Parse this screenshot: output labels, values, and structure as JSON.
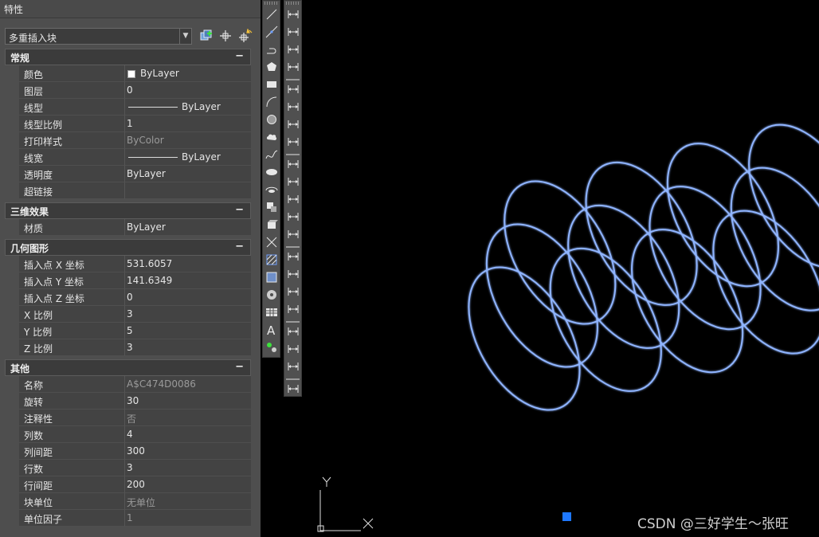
{
  "palette": {
    "title": "特性",
    "selector": "多重插入块",
    "toolbar_icons": [
      "toggle-pickadd-icon",
      "select-objects-icon",
      "quick-select-icon"
    ],
    "sections": [
      {
        "title": "常规",
        "collapse": "−",
        "rows": [
          {
            "name": "颜色",
            "value": "ByLayer",
            "glyph": "swatch"
          },
          {
            "name": "图层",
            "value": "0"
          },
          {
            "name": "线型",
            "value": "ByLayer",
            "glyph": "line"
          },
          {
            "name": "线型比例",
            "value": "1"
          },
          {
            "name": "打印样式",
            "value": "ByColor",
            "dim": true
          },
          {
            "name": "线宽",
            "value": "ByLayer",
            "glyph": "line"
          },
          {
            "name": "透明度",
            "value": "ByLayer"
          },
          {
            "name": "超链接",
            "value": ""
          }
        ]
      },
      {
        "title": "三维效果",
        "collapse": "−",
        "rows": [
          {
            "name": "材质",
            "value": "ByLayer"
          }
        ]
      },
      {
        "title": "几何图形",
        "collapse": "−",
        "rows": [
          {
            "name": "插入点 X 坐标",
            "value": "531.6057"
          },
          {
            "name": "插入点 Y 坐标",
            "value": "141.6349"
          },
          {
            "name": "插入点 Z 坐标",
            "value": "0"
          },
          {
            "name": "X 比例",
            "value": "3"
          },
          {
            "name": "Y 比例",
            "value": "5"
          },
          {
            "name": "Z 比例",
            "value": "3"
          }
        ]
      },
      {
        "title": "其他",
        "collapse": "−",
        "rows": [
          {
            "name": "名称",
            "value": "A$C474D0086",
            "dim": true
          },
          {
            "name": "旋转",
            "value": "30"
          },
          {
            "name": "注释性",
            "value": "否",
            "dim": true
          },
          {
            "name": "列数",
            "value": "4"
          },
          {
            "name": "列间距",
            "value": "300"
          },
          {
            "name": "行数",
            "value": "3"
          },
          {
            "name": "行间距",
            "value": "200"
          },
          {
            "name": "块单位",
            "value": "无单位",
            "dim": true
          },
          {
            "name": "单位因子",
            "value": "1",
            "dim": true
          }
        ]
      }
    ]
  },
  "draw_toolbar": [
    "line-icon",
    "construction-line-icon",
    "polyline-icon",
    "polygon-icon",
    "rectangle-icon",
    "arc-icon",
    "circle-icon",
    "revision-cloud-icon",
    "spline-icon",
    "ellipse-icon",
    "ellipse-arc-icon",
    "insert-block-icon",
    "make-block-icon",
    "point-icon",
    "hatch-icon",
    "gradient-icon",
    "region-icon",
    "table-icon",
    "multiline-text-icon",
    "add-selected-icon"
  ],
  "dim_toolbar": [
    "linear-dimension-icon",
    "aligned-dimension-icon",
    "arc-length-icon",
    "ordinate-icon",
    "radius-icon",
    "jogged-icon",
    "diameter-icon",
    "angular-icon",
    "quick-dimension-icon",
    "baseline-icon",
    "continue-icon",
    "dimension-space-icon",
    "dimension-break-icon",
    "tolerance-icon",
    "center-mark-icon",
    "inspection-icon",
    "jogged-linear-icon",
    "dimension-edit-icon",
    "dimension-text-edit-icon",
    "dimension-update-icon",
    "dimension-style-icon"
  ],
  "canvas": {
    "ucs_x": "X",
    "ucs_y": "Y",
    "watermark": "CSDN @三好学生～张旺",
    "ellipse_color": "#8fb4ff",
    "array": {
      "columns": 4,
      "rows": 3,
      "column_spacing": 300,
      "row_spacing": 200,
      "rotation_deg": 30
    }
  }
}
